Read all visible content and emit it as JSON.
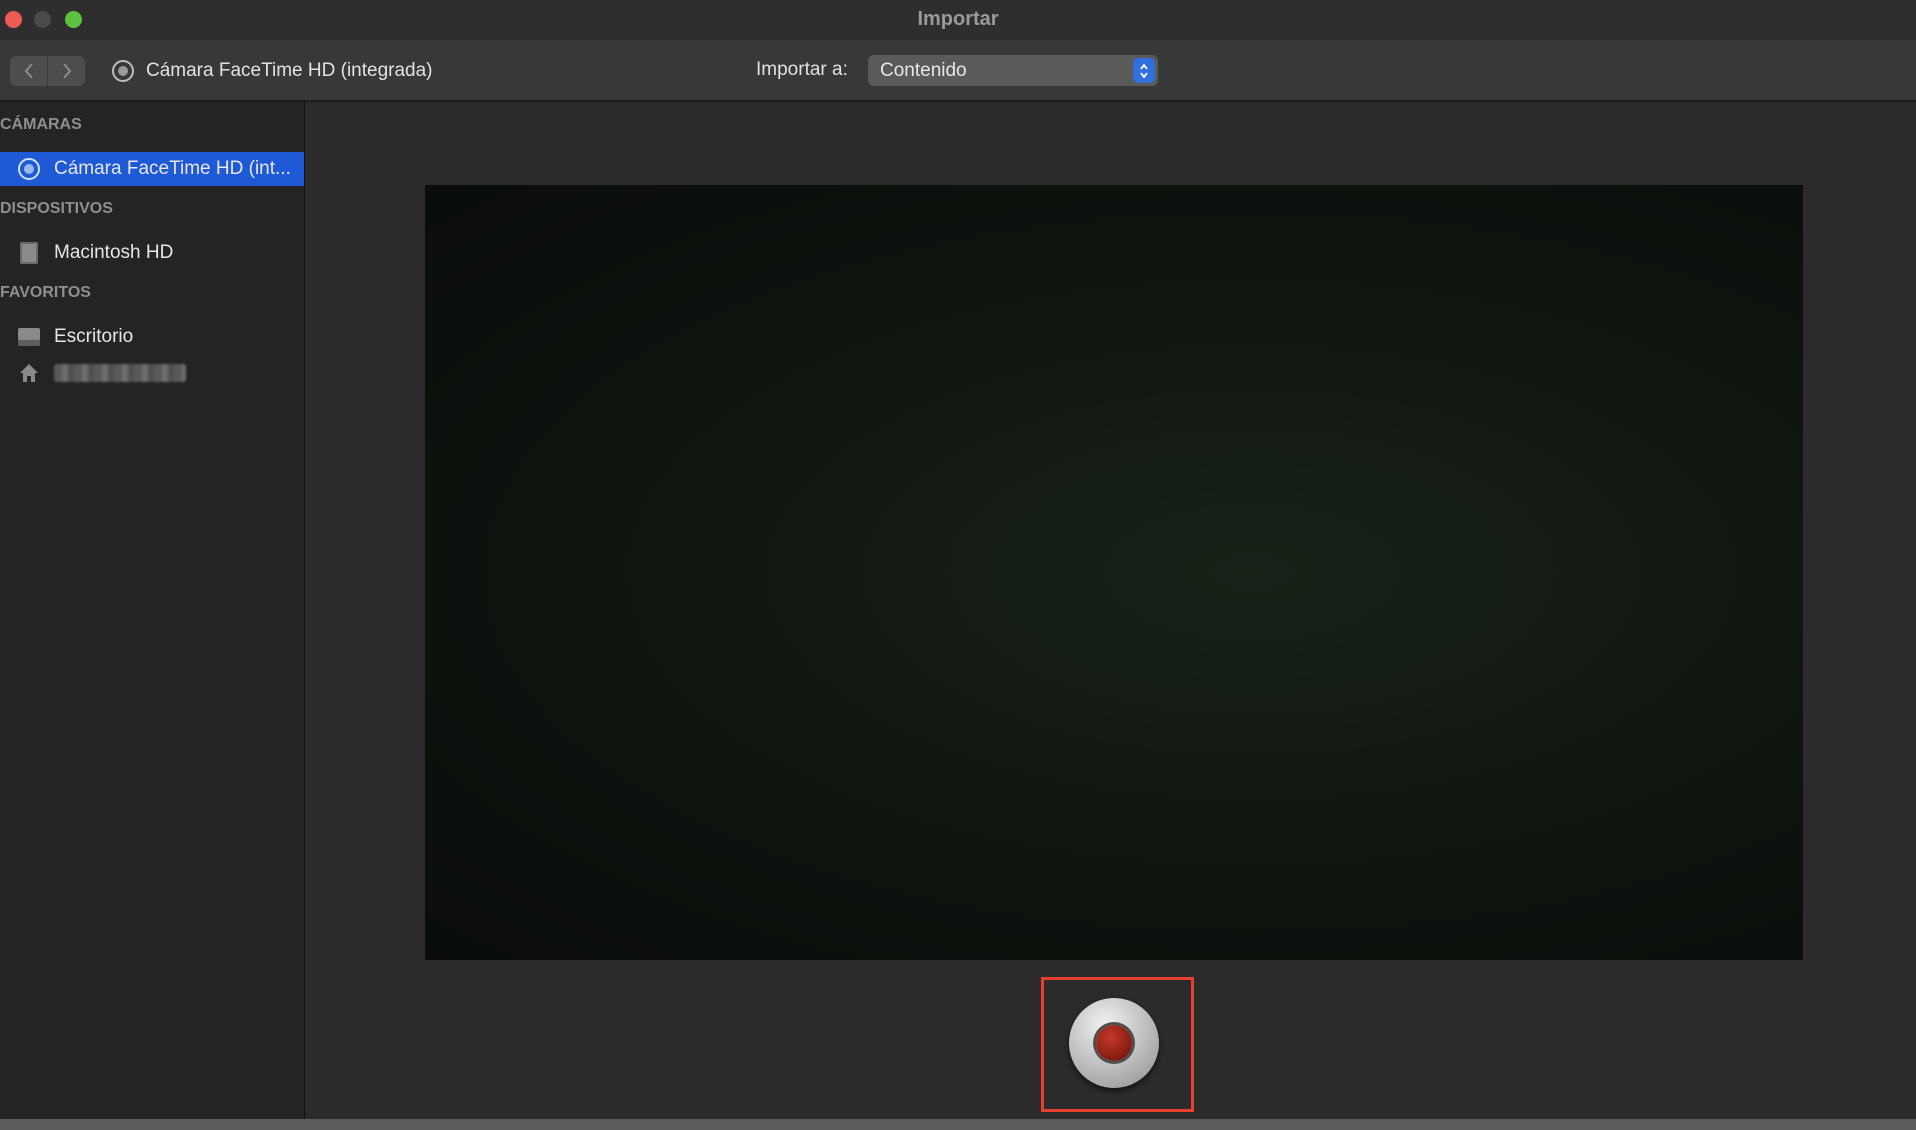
{
  "window": {
    "title": "Importar"
  },
  "toolbar": {
    "device_title": "Cámara FaceTime HD (integrada)",
    "import_label": "Importar a:",
    "import_destination": "Contenido",
    "back_icon": "chevron-left-icon",
    "forward_icon": "chevron-right-icon"
  },
  "sidebar": {
    "sections": [
      {
        "header": "CÁMARAS",
        "items": [
          {
            "label": "Cámara FaceTime HD (int...",
            "icon": "camera-icon",
            "selected": true
          }
        ]
      },
      {
        "header": "DISPOSITIVOS",
        "items": [
          {
            "label": "Macintosh HD",
            "icon": "hard-disk-icon",
            "selected": false
          }
        ]
      },
      {
        "header": "FAVORITOS",
        "items": [
          {
            "label": "Escritorio",
            "icon": "desktop-icon",
            "selected": false
          },
          {
            "label": "",
            "icon": "home-icon",
            "selected": false,
            "redacted": true
          }
        ]
      }
    ]
  },
  "main": {
    "record_button_icon": "record-icon"
  },
  "colors": {
    "selection": "#1f5ad6",
    "select_arrows": "#2f6fde",
    "highlight_border": "#e8402e",
    "close": "#ed5b55",
    "maximize": "#5dc242"
  }
}
